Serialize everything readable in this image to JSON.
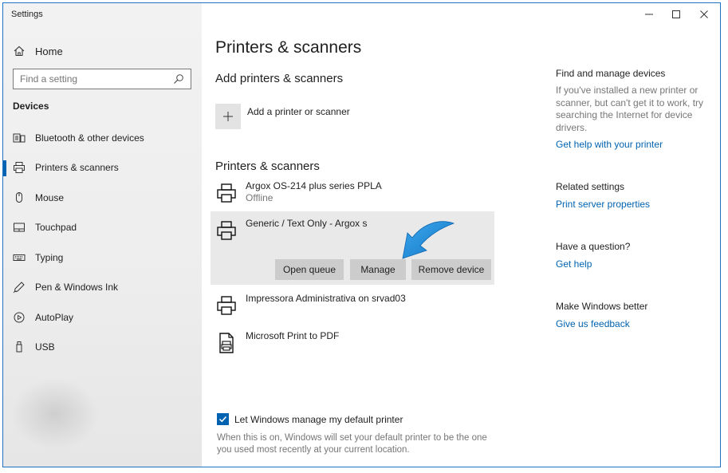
{
  "window": {
    "title": "Settings",
    "controls": {
      "minimize": "—",
      "maximize": "☐",
      "close": "✕"
    }
  },
  "sidebar": {
    "home_label": "Home",
    "search_placeholder": "Find a setting",
    "section_label": "Devices",
    "items": [
      {
        "label": "Bluetooth & other devices",
        "icon": "bluetooth-devices-icon"
      },
      {
        "label": "Printers & scanners",
        "icon": "printer-icon",
        "active": true
      },
      {
        "label": "Mouse",
        "icon": "mouse-icon"
      },
      {
        "label": "Touchpad",
        "icon": "touchpad-icon"
      },
      {
        "label": "Typing",
        "icon": "keyboard-icon"
      },
      {
        "label": "Pen & Windows Ink",
        "icon": "pen-icon"
      },
      {
        "label": "AutoPlay",
        "icon": "autoplay-icon"
      },
      {
        "label": "USB",
        "icon": "usb-icon"
      }
    ]
  },
  "main": {
    "title": "Printers & scanners",
    "add_section_title": "Add printers & scanners",
    "add_button_label": "Add a printer or scanner",
    "list_section_title": "Printers & scanners",
    "printers": [
      {
        "name": "Argox OS-214 plus series PPLA",
        "status": "Offline",
        "icon": "printer-icon"
      },
      {
        "name": "Generic / Text Only - Argox s",
        "status": "",
        "icon": "printer-icon",
        "selected": true
      },
      {
        "name": "Impressora Administrativa on srvad03",
        "status": "",
        "icon": "printer-icon"
      },
      {
        "name": "Microsoft Print to PDF",
        "status": "",
        "icon": "pdf-printer-icon"
      }
    ],
    "actions": {
      "open_queue": "Open queue",
      "manage": "Manage",
      "remove_device": "Remove device"
    },
    "default_printer_checkbox": {
      "label": "Let Windows manage my default printer",
      "checked": true
    },
    "default_printer_note": "When this is on, Windows will set your default printer to be the one you used most recently at your current location."
  },
  "right_panel": {
    "find_heading": "Find and manage devices",
    "find_text": "If you've installed a new printer or scanner, but can't get it to work, try searching the Internet for device drivers.",
    "find_link": "Get help with your printer",
    "related_heading": "Related settings",
    "related_link": "Print server properties",
    "question_heading": "Have a question?",
    "question_link": "Get help",
    "better_heading": "Make Windows better",
    "better_link": "Give us feedback"
  },
  "colors": {
    "accent": "#0063b1",
    "arrow": "#1a8fdc",
    "button_bg": "#cccccc",
    "selected_bg": "#e9e9e9"
  }
}
